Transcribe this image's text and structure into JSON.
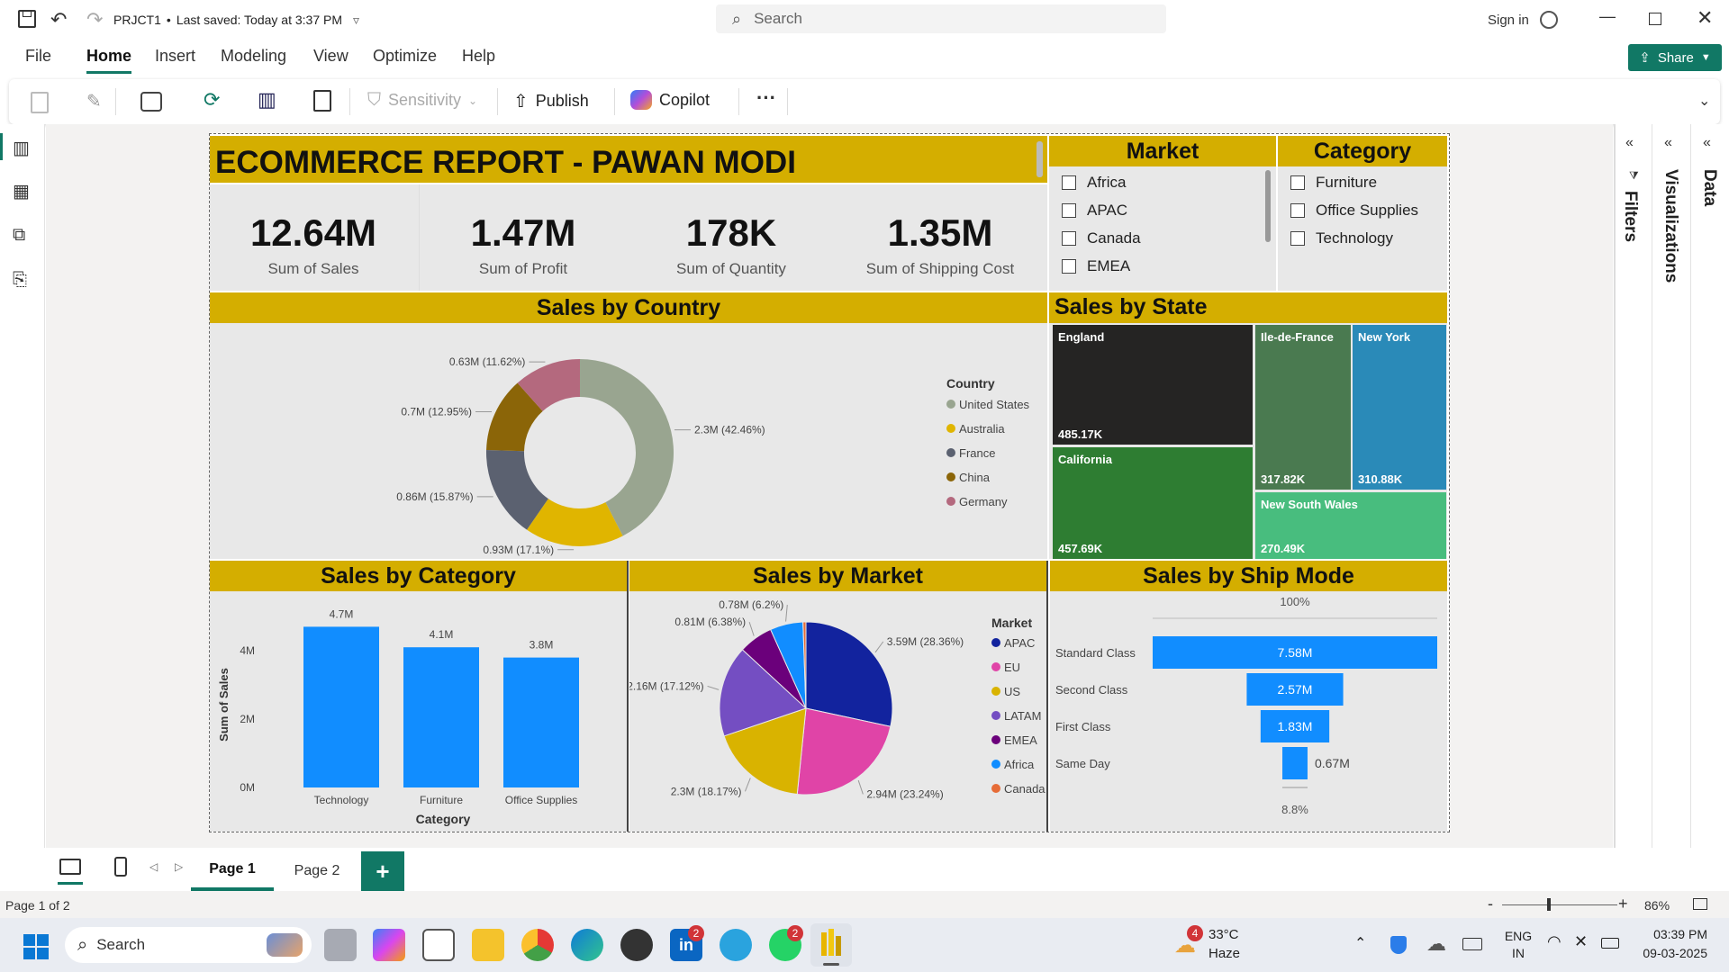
{
  "titlebar": {
    "project": "PRJCT1",
    "saved": "Last saved: Today at 3:37 PM",
    "search_placeholder": "Search",
    "signin": "Sign in"
  },
  "ribbon_tabs": [
    "File",
    "Home",
    "Insert",
    "Modeling",
    "View",
    "Optimize",
    "Help"
  ],
  "share_label": "Share",
  "ribbon": {
    "sensitivity": "Sensitivity",
    "publish": "Publish",
    "copilot": "Copilot",
    "more": "···"
  },
  "report": {
    "title": "ECOMMERCE REPORT - PAWAN MODI",
    "kpis": [
      {
        "value": "12.64M",
        "label": "Sum of Sales"
      },
      {
        "value": "1.47M",
        "label": "Sum of Profit"
      },
      {
        "value": "178K",
        "label": "Sum of Quantity"
      },
      {
        "value": "1.35M",
        "label": "Sum of Shipping Cost"
      }
    ],
    "market_slicer": {
      "title": "Market",
      "items": [
        "Africa",
        "APAC",
        "Canada",
        "EMEA"
      ]
    },
    "category_slicer": {
      "title": "Category",
      "items": [
        "Furniture",
        "Office Supplies",
        "Technology"
      ]
    }
  },
  "colors": {
    "gold": "#d4ae00",
    "bar_blue": "#118dff",
    "green_accent": "#117865"
  },
  "chart_data": [
    {
      "type": "pie",
      "title": "Sales by Country",
      "legend_title": "Country",
      "legend_position": "right",
      "donut": true,
      "slices": [
        {
          "label": "United States",
          "value": 2.3,
          "text": "2.3M (42.46%)",
          "color": "#99a590"
        },
        {
          "label": "Australia",
          "value": 0.93,
          "text": "0.93M (17.1%)",
          "color": "#e0b500"
        },
        {
          "label": "France",
          "value": 0.86,
          "text": "0.86M (15.87%)",
          "color": "#5b6170"
        },
        {
          "label": "China",
          "value": 0.7,
          "text": "0.7M (12.95%)",
          "color": "#8b6508"
        },
        {
          "label": "Germany",
          "value": 0.63,
          "text": "0.63M (11.62%)",
          "color": "#b4697e"
        }
      ]
    },
    {
      "type": "treemap",
      "title": "Sales by State",
      "items": [
        {
          "label": "England",
          "value": "485.17K",
          "color": "#252423"
        },
        {
          "label": "California",
          "value": "457.69K",
          "color": "#2e7d32"
        },
        {
          "label": "Ile-de-France",
          "value": "317.82K",
          "color": "#4a7a50"
        },
        {
          "label": "New York",
          "value": "310.88K",
          "color": "#2a8ab8"
        },
        {
          "label": "New South Wales",
          "value": "270.49K",
          "color": "#48bd7e"
        }
      ]
    },
    {
      "type": "bar",
      "title": "Sales by Category",
      "categories": [
        "Technology",
        "Furniture",
        "Office Supplies"
      ],
      "values": [
        4.7,
        4.1,
        3.8
      ],
      "value_labels": [
        "4.7M",
        "4.1M",
        "3.8M"
      ],
      "xlabel": "Category",
      "ylabel": "Sum of Sales",
      "yticks": [
        "0M",
        "2M",
        "4M"
      ],
      "ylim": [
        0,
        5
      ]
    },
    {
      "type": "pie",
      "title": "Sales by Market",
      "legend_title": "Market",
      "legend_position": "right",
      "slices": [
        {
          "label": "APAC",
          "value": 3.59,
          "text": "3.59M (28.36%)",
          "color": "#12239e"
        },
        {
          "label": "EU",
          "value": 2.94,
          "text": "2.94M (23.24%)",
          "color": "#e044a7"
        },
        {
          "label": "US",
          "value": 2.3,
          "text": "2.3M (18.17%)",
          "color": "#d9b300"
        },
        {
          "label": "LATAM",
          "value": 2.16,
          "text": "2.16M (17.12%)",
          "color": "#744ec2"
        },
        {
          "label": "EMEA",
          "value": 0.81,
          "text": "0.81M (6.38%)",
          "color": "#6b007b"
        },
        {
          "label": "Africa",
          "value": 0.78,
          "text": "0.78M (6.2%)",
          "color": "#118dff"
        },
        {
          "label": "Canada",
          "value": 0.07,
          "text": "",
          "color": "#e66c37"
        }
      ]
    },
    {
      "type": "bar",
      "title": "Sales by Ship Mode",
      "orientation": "funnel",
      "categories": [
        "Standard Class",
        "Second Class",
        "First Class",
        "Same Day"
      ],
      "values": [
        7.58,
        2.57,
        1.83,
        0.67
      ],
      "value_labels": [
        "7.58M",
        "2.57M",
        "1.83M",
        "0.67M"
      ],
      "top_percent": "100%",
      "bottom_percent": "8.8%"
    }
  ],
  "pages": [
    "Page 1",
    "Page 2"
  ],
  "status": {
    "page": "Page 1 of 2",
    "zoom": "86%"
  },
  "right_panes": [
    "Data",
    "Visualizations",
    "Filters"
  ],
  "taskbar": {
    "search": "Search",
    "weather_temp": "33°C",
    "weather_desc": "Haze",
    "lang1": "ENG",
    "lang2": "IN",
    "time": "03:39 PM",
    "date": "09-03-2025",
    "badge_weather": "4",
    "badge_linkedin": "2",
    "badge_whatsapp": "2"
  }
}
